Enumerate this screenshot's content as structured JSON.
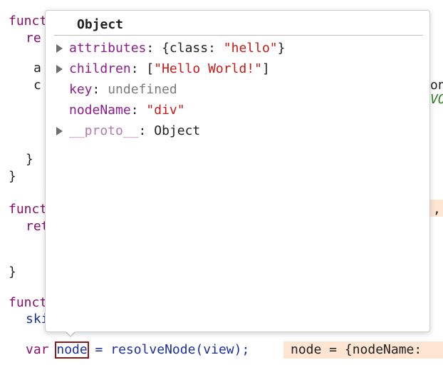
{
  "popover": {
    "title": "Object",
    "properties": [
      {
        "key": "attributes",
        "sep": ": ",
        "value_prefix": "{class: ",
        "value_str": "\"hello\"",
        "value_suffix": "}",
        "expandable": true
      },
      {
        "key": "children",
        "sep": ": ",
        "value_prefix": "[",
        "value_str": "\"Hello World!\"",
        "value_suffix": "]",
        "expandable": true
      },
      {
        "key": "key",
        "sep": ": ",
        "value_undef": "undefined",
        "expandable": false
      },
      {
        "key": "nodeName",
        "sep": ": ",
        "value_str": "\"div\"",
        "expandable": false
      },
      {
        "key": "__proto__",
        "sep": ": ",
        "value_obj": "Object",
        "expandable": true
      }
    ]
  },
  "code": {
    "frag_funct1": "funct",
    "frag_ret1": "re",
    "frag_a1": "a",
    "frag_c1": "c",
    "frag_on": "on",
    "frag_vol": "VOL",
    "frag_close1": "}",
    "frag_close2": "}",
    "frag_funct2": "funct",
    "frag_ret2": "ret",
    "frag_comma": ",",
    "frag_close3": "}",
    "frag_funct3": "funct",
    "frag_ski": "ski",
    "bottom_var": "var ",
    "bottom_node": "node",
    "bottom_rest": " = resolveNode(view);",
    "inline_value": "node = {nodeName:"
  }
}
